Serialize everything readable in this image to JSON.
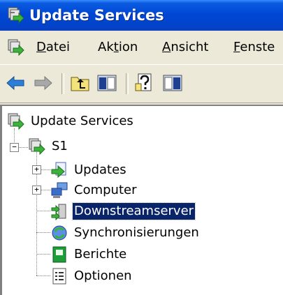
{
  "window": {
    "title": "Update Services",
    "icon": "update-services-icon"
  },
  "menubar": {
    "items": [
      {
        "pre": "",
        "ul": "D",
        "post": "atei"
      },
      {
        "pre": "Ak",
        "ul": "t",
        "post": "ion"
      },
      {
        "pre": "",
        "ul": "A",
        "post": "nsicht"
      },
      {
        "pre": "",
        "ul": "F",
        "post": "enste"
      }
    ]
  },
  "toolbar": {
    "buttons": [
      "back-arrow-icon",
      "forward-arrow-icon",
      "up-folder-icon",
      "show-hide-console-tree-icon",
      "help-icon",
      "show-hide-action-pane-icon"
    ]
  },
  "tree": {
    "root": {
      "label": "Update Services",
      "icon": "update-services-icon"
    },
    "server": {
      "label": "S1",
      "icon": "server-icon",
      "expanded": true
    },
    "children": [
      {
        "label": "Updates",
        "icon": "updates-icon",
        "expandable": true,
        "selected": false
      },
      {
        "label": "Computer",
        "icon": "computers-icon",
        "expandable": true,
        "selected": false
      },
      {
        "label": "Downstreamserver",
        "icon": "downstream-server-icon",
        "expandable": false,
        "selected": true
      },
      {
        "label": "Synchronisierungen",
        "icon": "synchronization-icon",
        "expandable": false,
        "selected": false
      },
      {
        "label": "Berichte",
        "icon": "reports-icon",
        "expandable": false,
        "selected": false
      },
      {
        "label": "Optionen",
        "icon": "options-icon",
        "expandable": false,
        "selected": false
      }
    ]
  },
  "colors": {
    "titlebar": "#0047d5",
    "selection": "#0a246a",
    "chrome": "#ece9d8"
  }
}
